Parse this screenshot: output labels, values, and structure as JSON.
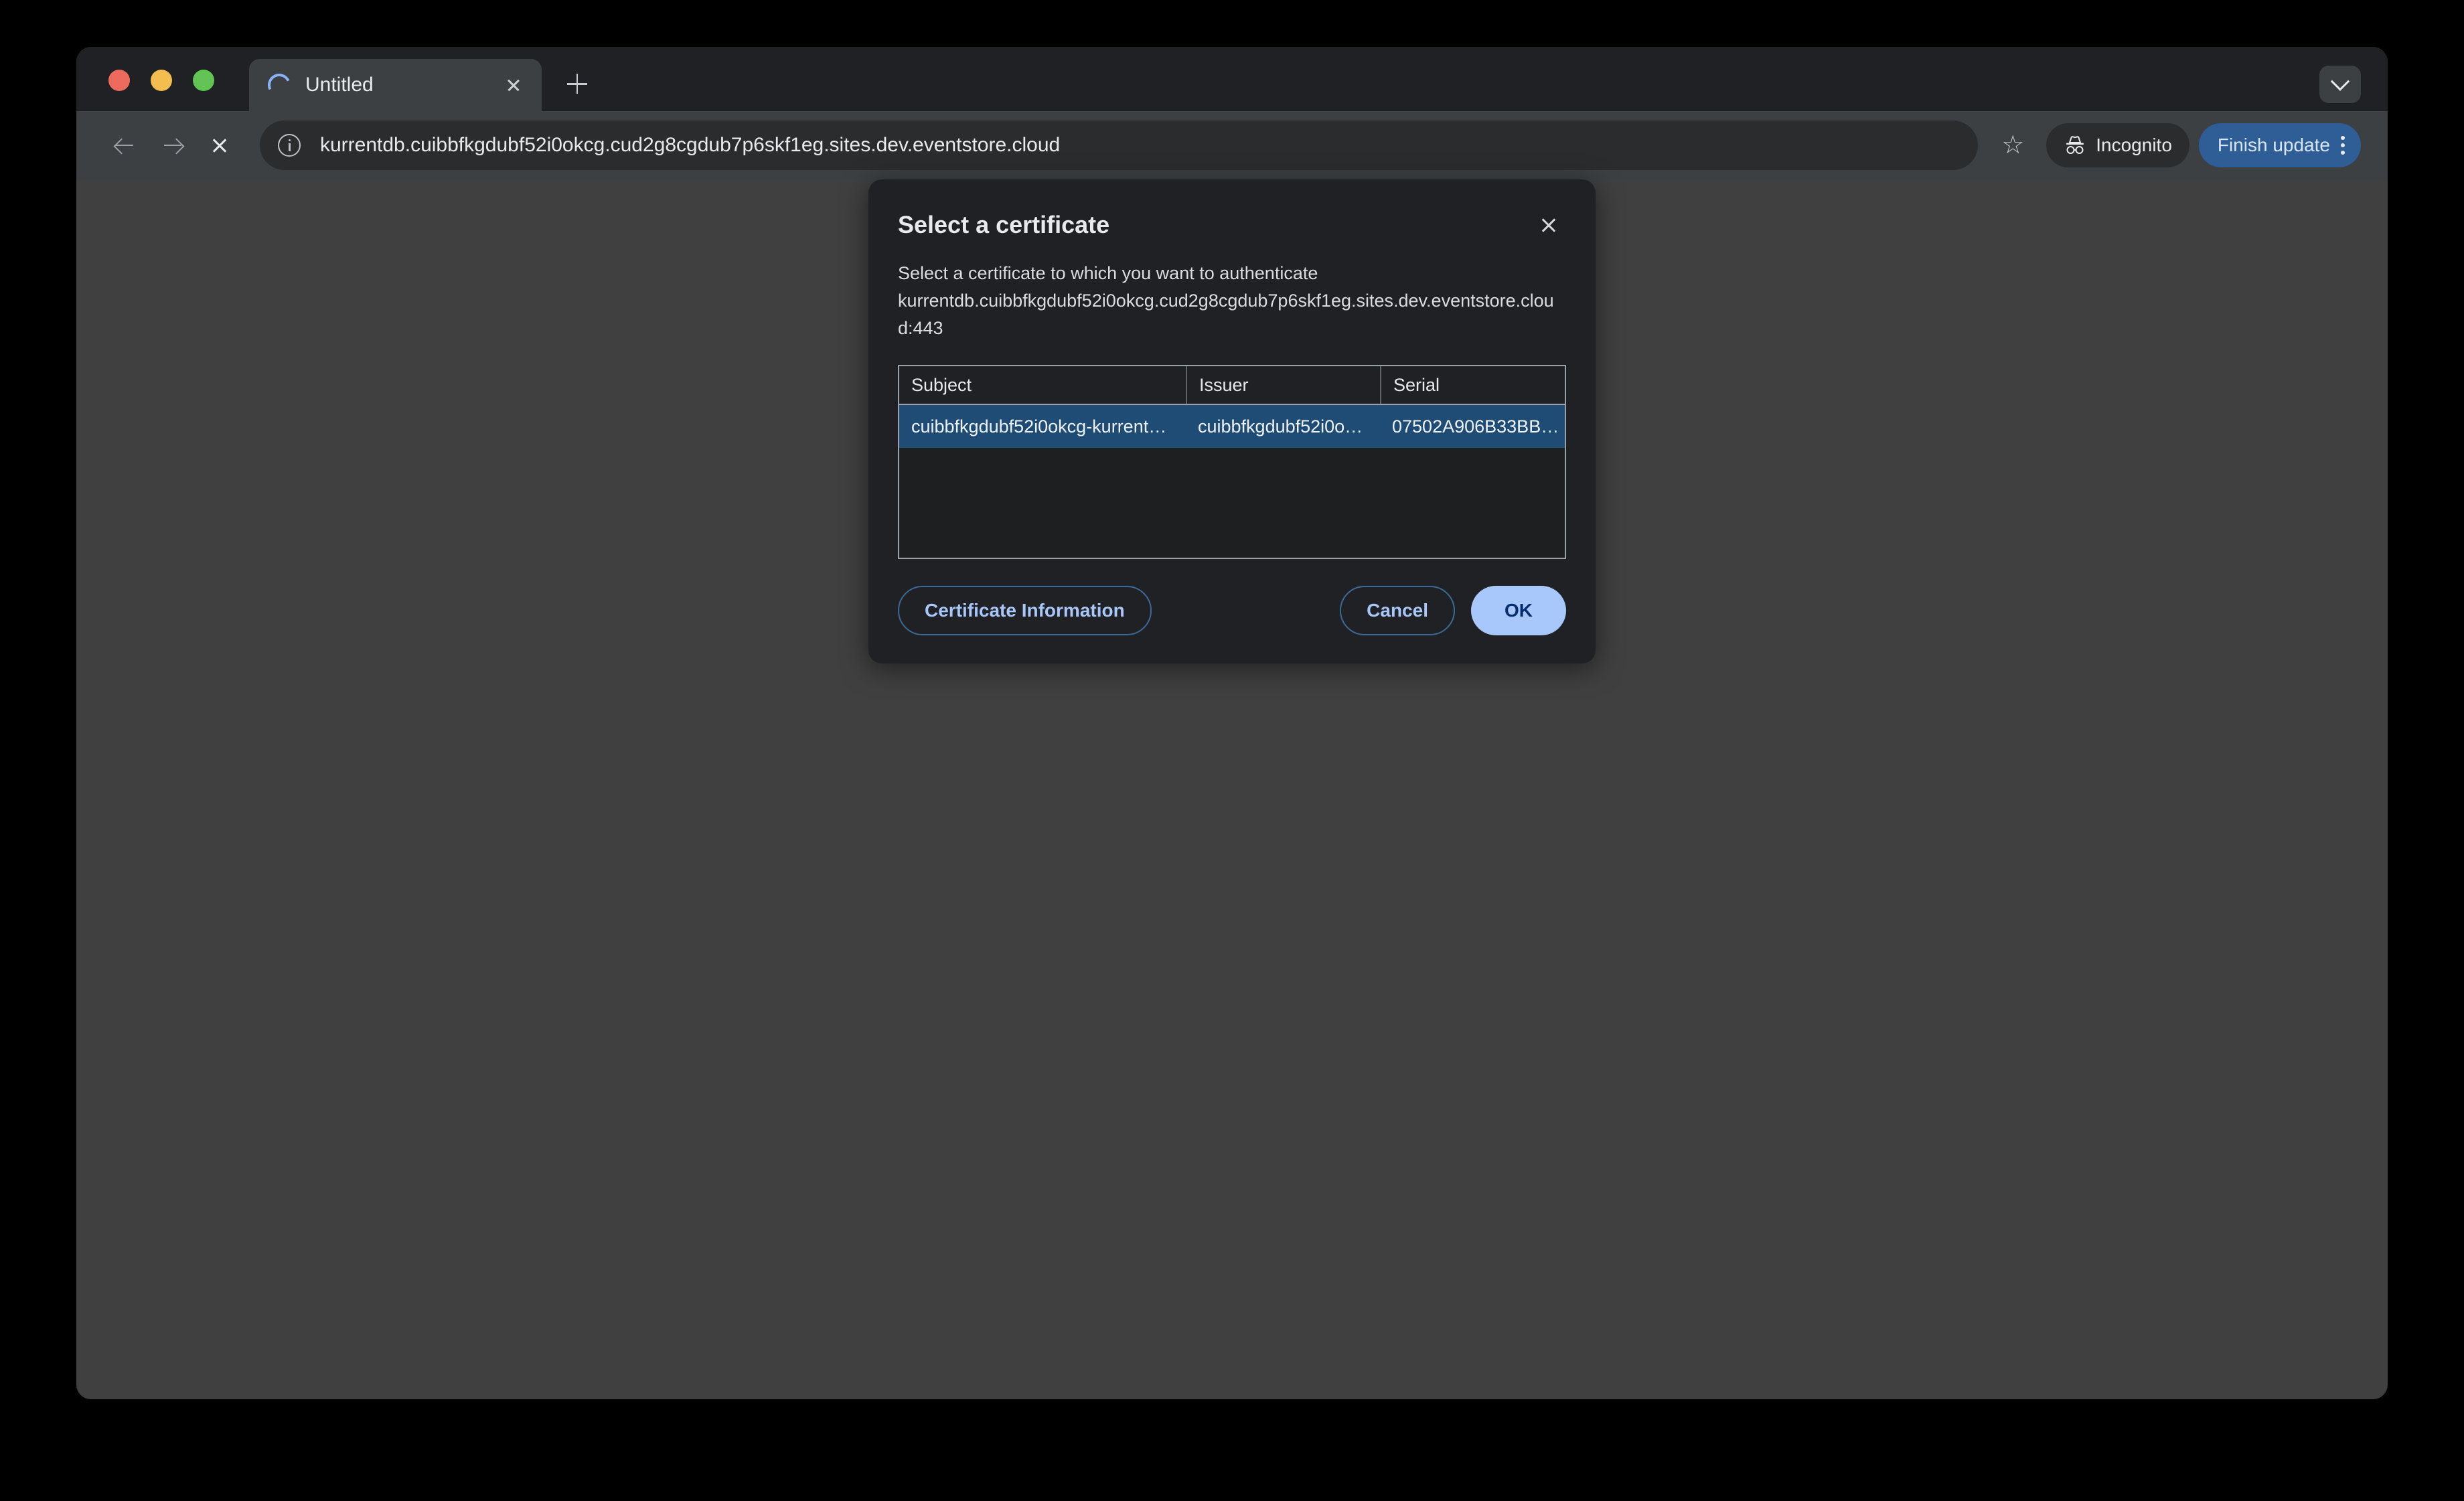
{
  "window": {
    "traffic_lights": [
      "close",
      "minimize",
      "maximize"
    ]
  },
  "tab_strip": {
    "active_tab": {
      "title": "Untitled",
      "favicon": "loading-spinner",
      "close_label": "×"
    },
    "new_tab_label": "+",
    "tab_search_icon": "chevron-down-icon"
  },
  "toolbar": {
    "back_icon": "arrow-left-icon",
    "forward_icon": "arrow-right-icon",
    "stop_icon": "close-x-icon",
    "site_info_icon": "info-circle-icon",
    "url": "kurrentdb.cuibbfkgdubf52i0okcg.cud2g8cgdub7p6skf1eg.sites.dev.eventstore.cloud",
    "bookmark_icon": "☆",
    "incognito_label": "Incognito",
    "incognito_icon": "incognito-hat-icon",
    "finish_update_label": "Finish update",
    "menu_icon": "three-dots-vertical-icon"
  },
  "dialog": {
    "title": "Select a certificate",
    "close_icon": "close-icon",
    "description_line1": "Select a certificate to which you want to authenticate",
    "description_host": "kurrentdb.cuibbfkgdubf52i0okcg.cud2g8cgdub7p6skf1eg.sites.dev.eventstore.cloud:443",
    "table": {
      "columns": [
        "Subject",
        "Issuer",
        "Serial"
      ],
      "rows": [
        {
          "subject": "cuibbfkgdubf52i0okcg-kurrent…",
          "issuer": "cuibbfkgdubf52i0o…",
          "serial": "07502A906B33BB…",
          "selected": true
        }
      ]
    },
    "buttons": {
      "certificate_information": "Certificate Information",
      "cancel": "Cancel",
      "ok": "OK"
    }
  },
  "colors": {
    "window_chrome": "#202124",
    "toolbar": "#3c4043",
    "page_background": "#404040",
    "selected_row": "#1f4c75",
    "accent_button": "#a8c7fa",
    "update_button": "#2f5d95"
  }
}
